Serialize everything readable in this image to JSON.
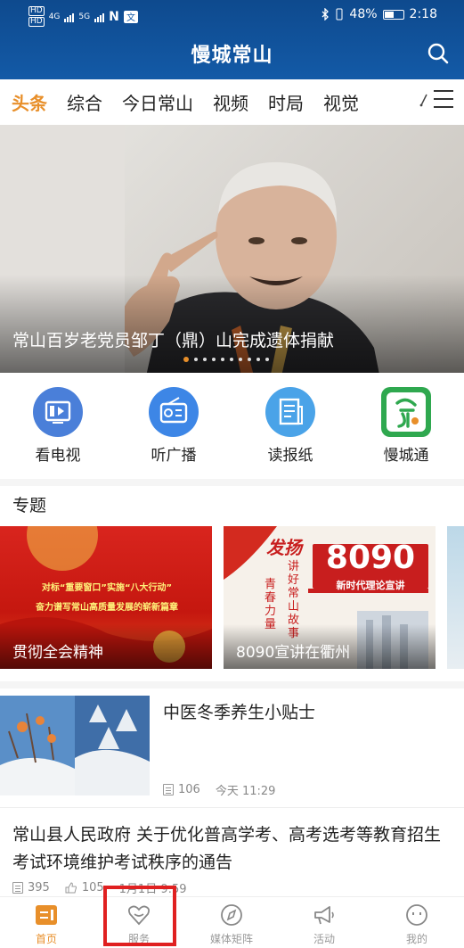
{
  "status_bar": {
    "carrier_1": "HD",
    "carrier_2": "HD",
    "signal_1": "4G",
    "signal_2": "5G",
    "nfc": "N",
    "battery": "48%",
    "time": "2:18"
  },
  "header": {
    "title": "慢城常山",
    "search_icon": "search-icon"
  },
  "tabs": {
    "items": [
      {
        "label": "头条",
        "active": true
      },
      {
        "label": "综合",
        "active": false
      },
      {
        "label": "今日常山",
        "active": false
      },
      {
        "label": "视频",
        "active": false
      },
      {
        "label": "时局",
        "active": false
      },
      {
        "label": "视觉",
        "active": false
      }
    ],
    "menu_icon": "menu-icon"
  },
  "banner": {
    "caption": "常山百岁老党员邹丁（鼎）山完成遗体捐献",
    "slide_count": 10,
    "active_slide": 1
  },
  "quick_entries": [
    {
      "label": "看电视",
      "icon": "tv-icon",
      "color": "#4a7fd9"
    },
    {
      "label": "听广播",
      "icon": "radio-icon",
      "color": "#3d86e6"
    },
    {
      "label": "读报纸",
      "icon": "newspaper-icon",
      "color": "#4aa3e8"
    },
    {
      "label": "慢城通",
      "icon": "manchengtong-logo",
      "color": "#2fa84f"
    }
  ],
  "topics": {
    "title": "专题",
    "items": [
      {
        "label": "贯彻全会精神",
        "banner_line1": "对标“重要窗口”实施“八大行动”",
        "banner_line2": "奋力谱写常山高质量发展的崭新篇章"
      },
      {
        "label": "8090宣讲在衢州",
        "banner_big": "8090",
        "banner_sub": "新时代理论宣讲",
        "banner_calligraphy_1": "发扬",
        "banner_calligraphy_2": "青春力量",
        "banner_calligraphy_3": "讲好常山故事"
      }
    ]
  },
  "news": [
    {
      "title": "中医冬季养生小贴士",
      "views": "106",
      "time": "今天 11:29"
    },
    {
      "title": "常山县人民政府 关于优化普高学考、高考选考等教育招生考试环境维护考试秩序的通告",
      "views": "395",
      "likes": "105",
      "time": "1月1日 9:59"
    }
  ],
  "bottom_nav": [
    {
      "label": "首页",
      "icon": "home-icon",
      "active": true
    },
    {
      "label": "服务",
      "icon": "service-heart-icon",
      "active": false
    },
    {
      "label": "媒体矩阵",
      "icon": "compass-icon",
      "active": false
    },
    {
      "label": "活动",
      "icon": "megaphone-icon",
      "active": false
    },
    {
      "label": "我的",
      "icon": "profile-face-icon",
      "active": false
    }
  ],
  "colors": {
    "header_blue": "#135aa7",
    "accent_orange": "#e88f2a",
    "highlight_red": "#e02020"
  }
}
